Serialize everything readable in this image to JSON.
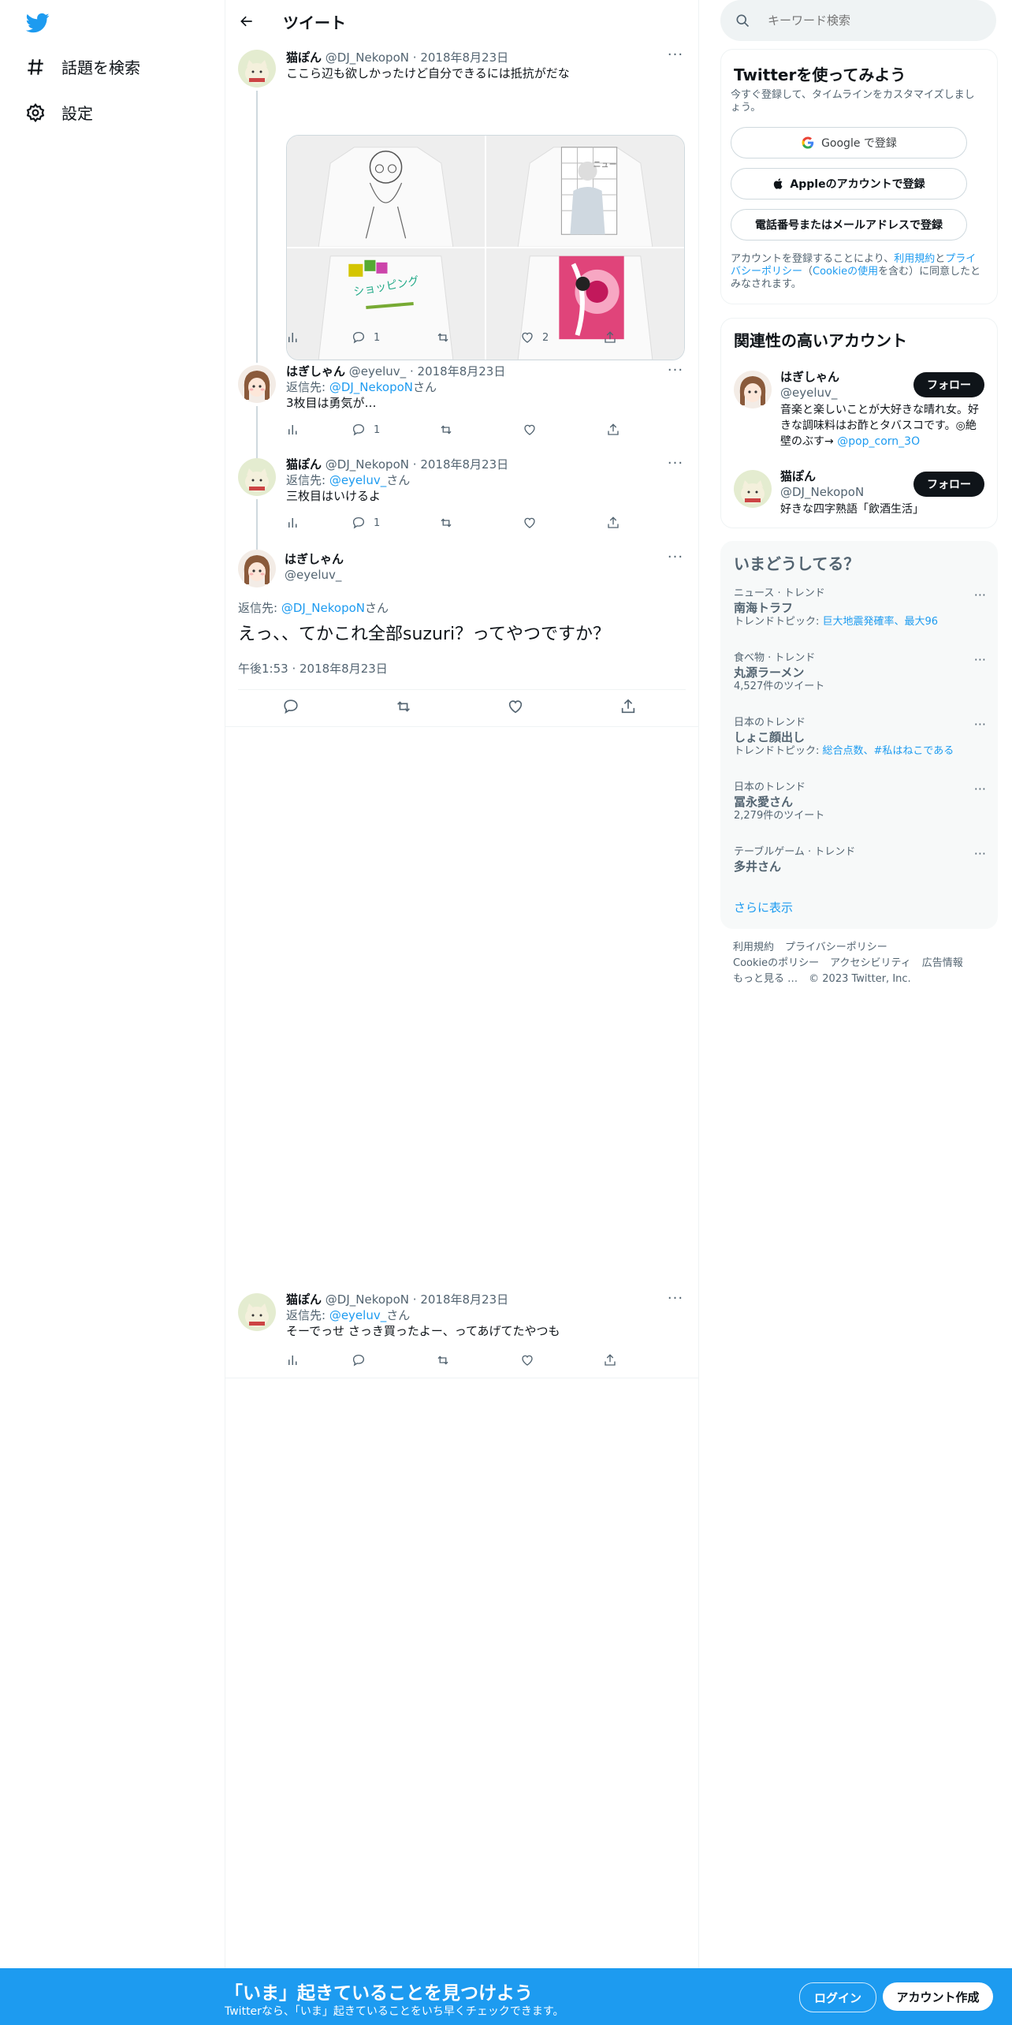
{
  "nav": {
    "explore_label": "話題を検索",
    "settings_label": "設定"
  },
  "header": {
    "title": "ツイート"
  },
  "tweets": [
    {
      "name": "猫ぽん",
      "handle": "@DJ_NekopoN",
      "sep": "·",
      "date": "2018年8月23日",
      "text": "ここら辺も欲しかったけど自分できるには抵抗がだな",
      "replies": "1",
      "retweets": "",
      "likes": "2",
      "images": [
        {
          "caption": ""
        },
        {
          "caption": "ニュー"
        },
        {
          "caption": "ショッピング"
        },
        {
          "caption": ""
        }
      ]
    },
    {
      "name": "はぎしゃん",
      "handle": "@eyeluv_",
      "sep": "·",
      "date": "2018年8月23日",
      "reply_prefix": "返信先: ",
      "reply_to": "@DJ_NekopoN",
      "reply_suffix": "さん",
      "text": "3枚目は勇気が…",
      "replies": "1"
    },
    {
      "name": "猫ぽん",
      "handle": "@DJ_NekopoN",
      "sep": "·",
      "date": "2018年8月23日",
      "reply_prefix": "返信先: ",
      "reply_to": "@eyeluv_",
      "reply_suffix": "さん",
      "text": "三枚目はいけるよ",
      "replies": "1"
    }
  ],
  "main_tweet": {
    "name": "はぎしゃん",
    "handle": "@eyeluv_",
    "reply_prefix": "返信先: ",
    "reply_to": "@DJ_NekopoN",
    "reply_suffix": "さん",
    "text": "えっ、、てかこれ全部suzuri？ってやつですか？",
    "time": "午後1:53 · 2018年8月23日"
  },
  "reply_tweet": {
    "name": "猫ぽん",
    "handle": "@DJ_NekopoN",
    "sep": "·",
    "date": "2018年8月23日",
    "reply_prefix": "返信先: ",
    "reply_to": "@eyeluv_",
    "reply_suffix": "さん",
    "text": "そーでっせ さっき買ったよー、ってあげてたやつも"
  },
  "search": {
    "placeholder": "キーワード検索"
  },
  "signup_panel": {
    "title": "Twitterを使ってみよう",
    "subtitle": "今すぐ登録して、タイムラインをカスタマイズしましょう。",
    "google_label": "Google で登録",
    "apple_label": "Appleのアカウントで登録",
    "phone_label": "電話番号またはメールアドレスで登録",
    "terms_prefix": "アカウントを登録することにより、",
    "terms_link": "利用規約",
    "terms_and": "と",
    "privacy_link": "プライバシーポリシー",
    "cookie_open": "（",
    "cookie_link": "Cookieの使用",
    "terms_suffix": "を含む）に同意したとみなされます。"
  },
  "related_panel": {
    "title": "関連性の高いアカウント",
    "accounts": [
      {
        "name": "はぎしゃん",
        "handle": "@eyeluv_",
        "bio": "音楽と楽しいことが大好きな晴れ女。好きな調味料はお酢とタバスコです。◎絶壁のぶす→ ",
        "bio_link": "@pop_corn_3O",
        "follow": "フォロー"
      },
      {
        "name": "猫ぽん",
        "handle": "@DJ_NekopoN",
        "bio": "好きな四字熟語「飲酒生活」",
        "follow": "フォロー"
      }
    ]
  },
  "trends_panel": {
    "title": "いまどうしてる？",
    "items": [
      {
        "meta": "ニュース · トレンド",
        "title": "南海トラフ",
        "sub_prefix": "トレンドトピック: ",
        "sub_link": "巨大地震発確率、最大96"
      },
      {
        "meta": "食べ物 · トレンド",
        "title": "丸源ラーメン",
        "sub": "4,527件のツイート"
      },
      {
        "meta": "日本のトレンド",
        "title": "しょこ顔出し",
        "sub_prefix": "トレンドトピック: ",
        "sub_link": "総合点数、#私はねこである"
      },
      {
        "meta": "日本のトレンド",
        "title": "冨永愛さん",
        "sub": "2,279件のツイート"
      },
      {
        "meta": "テーブルゲーム · トレンド",
        "title": "多井さん"
      }
    ],
    "more": "さらに表示"
  },
  "footer": {
    "terms": "利用規約",
    "privacy": "プライバシーポリシー",
    "cookie": "Cookieのポリシー",
    "accessibility": "アクセシビリティ",
    "ads": "広告情報",
    "more": "もっと見る …",
    "copyright": "© 2023 Twitter, Inc."
  },
  "bottom_bar": {
    "headline": "「いま」起きていることを見つけよう",
    "sub": "Twitterなら、「いま」起きていることをいち早くチェックできます。",
    "login": "ログイン",
    "signup": "アカウント作成"
  },
  "colors": {
    "accent": "#1d9bf0",
    "text": "#0f1419",
    "secondary": "#536471",
    "border": "#eff3f4"
  }
}
